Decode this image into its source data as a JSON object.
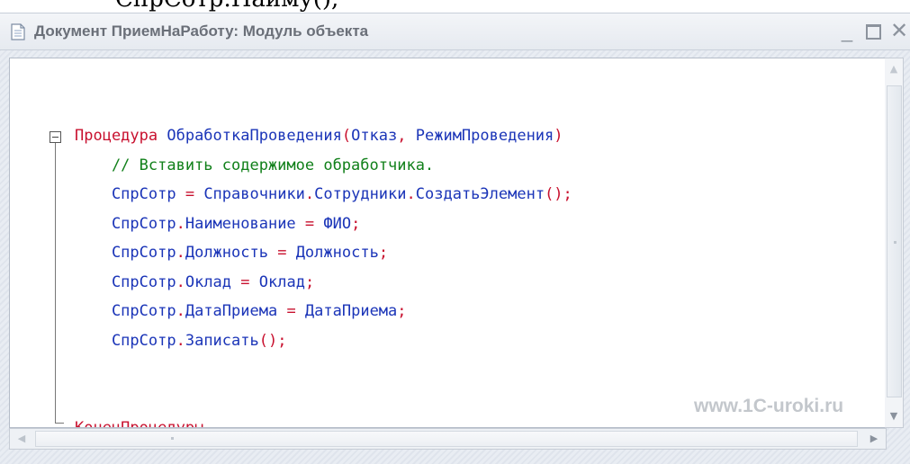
{
  "top_fragment": "СпрСотр.Наиму();",
  "window": {
    "title": "Документ ПриемНаРаботу: Модуль объекта",
    "minimize": "_",
    "close": "✕"
  },
  "code": {
    "lines": [
      [
        {
          "t": "Процедура ",
          "c": "kw"
        },
        {
          "t": "ОбработкаПроведения",
          "c": "ident"
        },
        {
          "t": "(",
          "c": "punct"
        },
        {
          "t": "Отказ",
          "c": "ident"
        },
        {
          "t": ", ",
          "c": "punct"
        },
        {
          "t": "РежимПроведения",
          "c": "ident"
        },
        {
          "t": ")",
          "c": "punct"
        }
      ],
      [
        {
          "t": "    // Вставить содержимое обработчика.",
          "c": "comment"
        }
      ],
      [
        {
          "t": "    СпрСотр ",
          "c": "ident"
        },
        {
          "t": "= ",
          "c": "punct"
        },
        {
          "t": "Справочники",
          "c": "ident"
        },
        {
          "t": ".",
          "c": "punct"
        },
        {
          "t": "Сотрудники",
          "c": "ident"
        },
        {
          "t": ".",
          "c": "punct"
        },
        {
          "t": "СоздатьЭлемент",
          "c": "ident"
        },
        {
          "t": "();",
          "c": "punct"
        }
      ],
      [
        {
          "t": "    СпрСотр",
          "c": "ident"
        },
        {
          "t": ".",
          "c": "punct"
        },
        {
          "t": "Наименование ",
          "c": "ident"
        },
        {
          "t": "= ",
          "c": "punct"
        },
        {
          "t": "ФИО",
          "c": "ident"
        },
        {
          "t": ";",
          "c": "punct"
        }
      ],
      [
        {
          "t": "    СпрСотр",
          "c": "ident"
        },
        {
          "t": ".",
          "c": "punct"
        },
        {
          "t": "Должность ",
          "c": "ident"
        },
        {
          "t": "= ",
          "c": "punct"
        },
        {
          "t": "Должность",
          "c": "ident"
        },
        {
          "t": ";",
          "c": "punct"
        }
      ],
      [
        {
          "t": "    СпрСотр",
          "c": "ident"
        },
        {
          "t": ".",
          "c": "punct"
        },
        {
          "t": "Оклад ",
          "c": "ident"
        },
        {
          "t": "= ",
          "c": "punct"
        },
        {
          "t": "Оклад",
          "c": "ident"
        },
        {
          "t": ";",
          "c": "punct"
        }
      ],
      [
        {
          "t": "    СпрСотр",
          "c": "ident"
        },
        {
          "t": ".",
          "c": "punct"
        },
        {
          "t": "ДатаПриема ",
          "c": "ident"
        },
        {
          "t": "= ",
          "c": "punct"
        },
        {
          "t": "ДатаПриема",
          "c": "ident"
        },
        {
          "t": ";",
          "c": "punct"
        }
      ],
      [
        {
          "t": "    СпрСотр",
          "c": "ident"
        },
        {
          "t": ".",
          "c": "punct"
        },
        {
          "t": "Записать",
          "c": "ident"
        },
        {
          "t": "();",
          "c": "punct"
        }
      ],
      [
        {
          "t": "",
          "c": "ident"
        }
      ],
      [
        {
          "t": "",
          "c": "ident"
        }
      ],
      [
        {
          "t": "КонецПроцедуры",
          "c": "kw"
        }
      ]
    ]
  },
  "watermark": "www.1C-uroki.ru",
  "icons": {
    "document": "document-icon",
    "fold": "fold-collapse-icon",
    "scroll_up": "▲",
    "scroll_down": "▼",
    "scroll_left": "◀",
    "scroll_right": "▶"
  },
  "colors": {
    "keyword": "#c8102e",
    "identifier": "#1b35b8",
    "comment": "#11801a"
  }
}
